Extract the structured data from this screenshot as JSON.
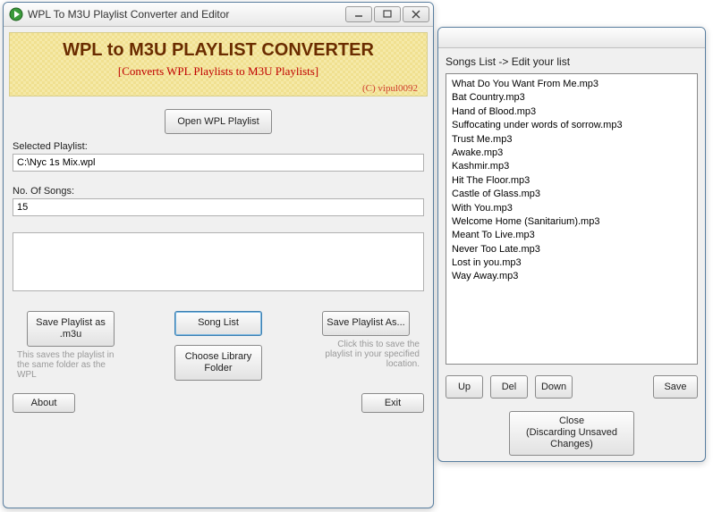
{
  "main": {
    "title": "WPL To M3U Playlist Converter and Editor",
    "banner_title": "WPL to M3U PLAYLIST CONVERTER",
    "banner_subtitle": "[Converts WPL Playlists to M3U Playlists]",
    "banner_credit": "(C) vipul0092",
    "open_btn": "Open WPL Playlist",
    "selected_label": "Selected Playlist:",
    "selected_value": "C:\\Nyc 1s Mix.wpl",
    "count_label": "No. Of Songs:",
    "count_value": "15",
    "save_m3u_btn": "Save Playlist as .m3u",
    "save_m3u_hint": "This saves the playlist in the same folder as the WPL",
    "song_list_btn": "Song List",
    "choose_lib_btn": "Choose Library Folder",
    "save_as_btn": "Save Playlist As...",
    "save_as_hint": "Click this to save the playlist in your specified location.",
    "about_btn": "About",
    "exit_btn": "Exit"
  },
  "songs": {
    "header": "Songs List -> Edit your list",
    "items": [
      "What Do You Want From Me.mp3",
      "Bat Country.mp3",
      "Hand of Blood.mp3",
      "Suffocating under words of sorrow.mp3",
      "Trust Me.mp3",
      "Awake.mp3",
      "Kashmir.mp3",
      "Hit The Floor.mp3",
      "Castle of Glass.mp3",
      "With You.mp3",
      "Welcome Home (Sanitarium).mp3",
      "Meant To Live.mp3",
      "Never Too Late.mp3",
      "Lost in you.mp3",
      "Way Away.mp3"
    ],
    "up_btn": "Up",
    "del_btn": "Del",
    "down_btn": "Down",
    "save_btn": "Save",
    "close_btn": "Close\n(Discarding Unsaved Changes)"
  }
}
